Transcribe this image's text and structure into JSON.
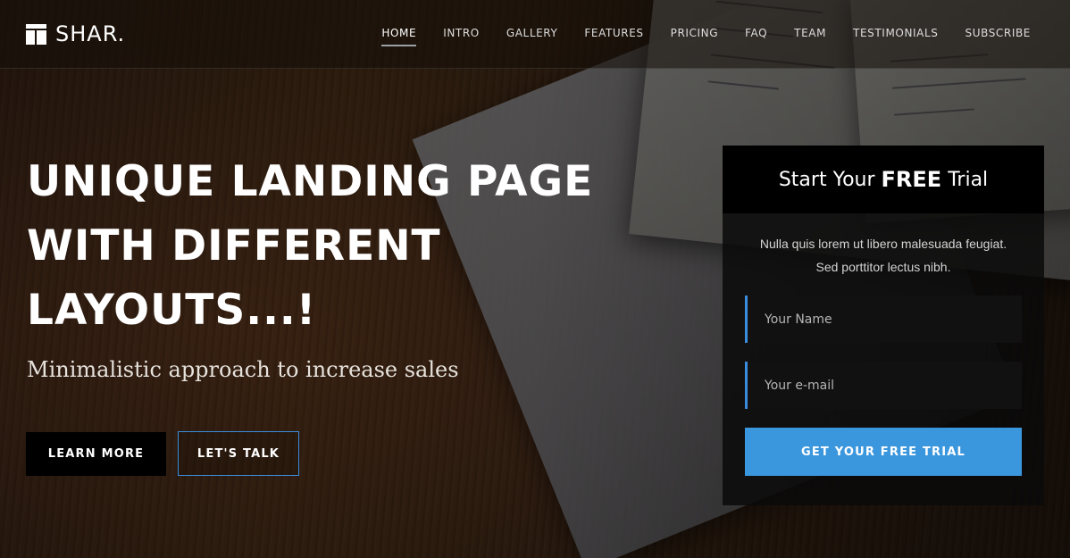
{
  "brand": {
    "name": "SHAR."
  },
  "nav": {
    "items": [
      {
        "label": "HOME",
        "active": true
      },
      {
        "label": "INTRO",
        "active": false
      },
      {
        "label": "GALLERY",
        "active": false
      },
      {
        "label": "FEATURES",
        "active": false
      },
      {
        "label": "PRICING",
        "active": false
      },
      {
        "label": "FAQ",
        "active": false
      },
      {
        "label": "TEAM",
        "active": false
      },
      {
        "label": "TESTIMONIALS",
        "active": false
      },
      {
        "label": "SUBSCRIBE",
        "active": false
      }
    ]
  },
  "hero": {
    "title_lines": [
      "UNIQUE LANDING PAGE",
      "WITH DIFFERENT",
      "LAYOUTS...!"
    ],
    "subtitle": "Minimalistic approach to increase sales",
    "learn_more": "LEARN MORE",
    "lets_talk": "LET'S TALK"
  },
  "trial": {
    "title_prefix": "Start Your",
    "title_emphasis": "FREE",
    "title_suffix": "Trial",
    "description_line1": "Nulla quis lorem ut libero malesuada feugiat.",
    "description_line2": "Sed porttitor lectus nibh.",
    "name_placeholder": "Your Name",
    "email_placeholder": "Your e-mail",
    "submit_label": "GET YOUR FREE TRIAL"
  },
  "colors": {
    "accent": "#3a96dd",
    "panel_bg": "#0a0a0a",
    "header_bg": "#140e0a"
  },
  "icons": {
    "logo": "grid-logo-icon"
  }
}
